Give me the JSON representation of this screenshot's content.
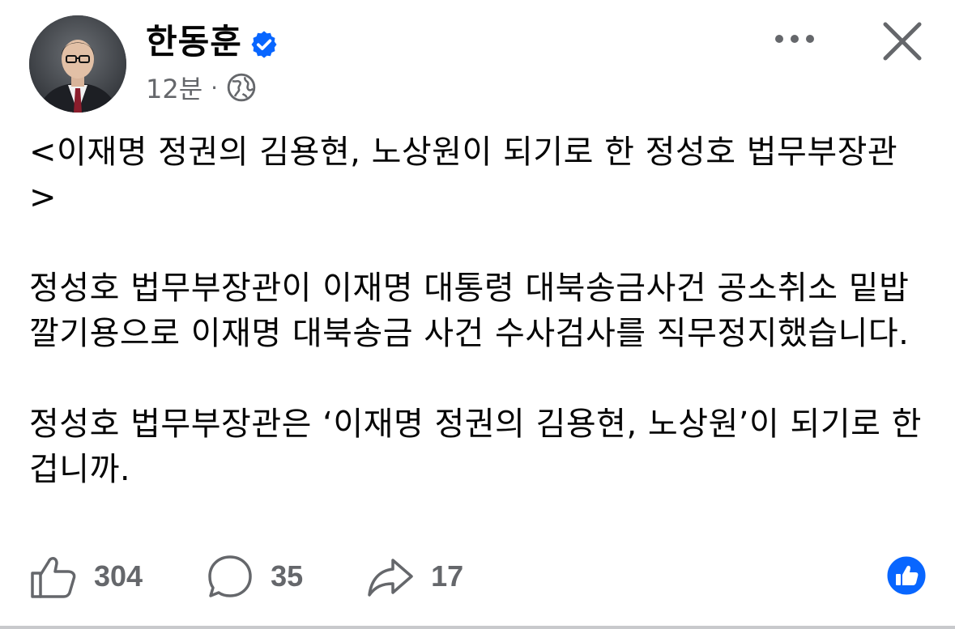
{
  "post": {
    "author": {
      "name": "한동훈",
      "verified_icon": "verified-badge-icon",
      "avatar_icon": "profile-photo"
    },
    "time": "12분",
    "separator": "·",
    "audience_icon": "globe-icon",
    "header_icons": {
      "more": "more-dots-icon",
      "close": "close-icon"
    },
    "paragraphs": [
      "<이재명 정권의 김용현, 노상원이 되기로 한 정성호 법무부장관 >",
      "정성호 법무부장관이 이재명 대통령 대북송금사건 공소취소 밑밥깔기용으로 이재명 대북송금 사건 수사검사를 직무정지했습니다.",
      "정성호 법무부장관은 ‘이재명 정권의 김용현, 노상원’이 되기로 한 겁니까."
    ],
    "actions": {
      "like_count": "304",
      "comment_count": "35",
      "share_count": "17"
    },
    "reaction_icon": "like-reaction-icon"
  },
  "colors": {
    "text": "#050505",
    "muted": "#65676b",
    "accent_blue": "#0866ff"
  }
}
